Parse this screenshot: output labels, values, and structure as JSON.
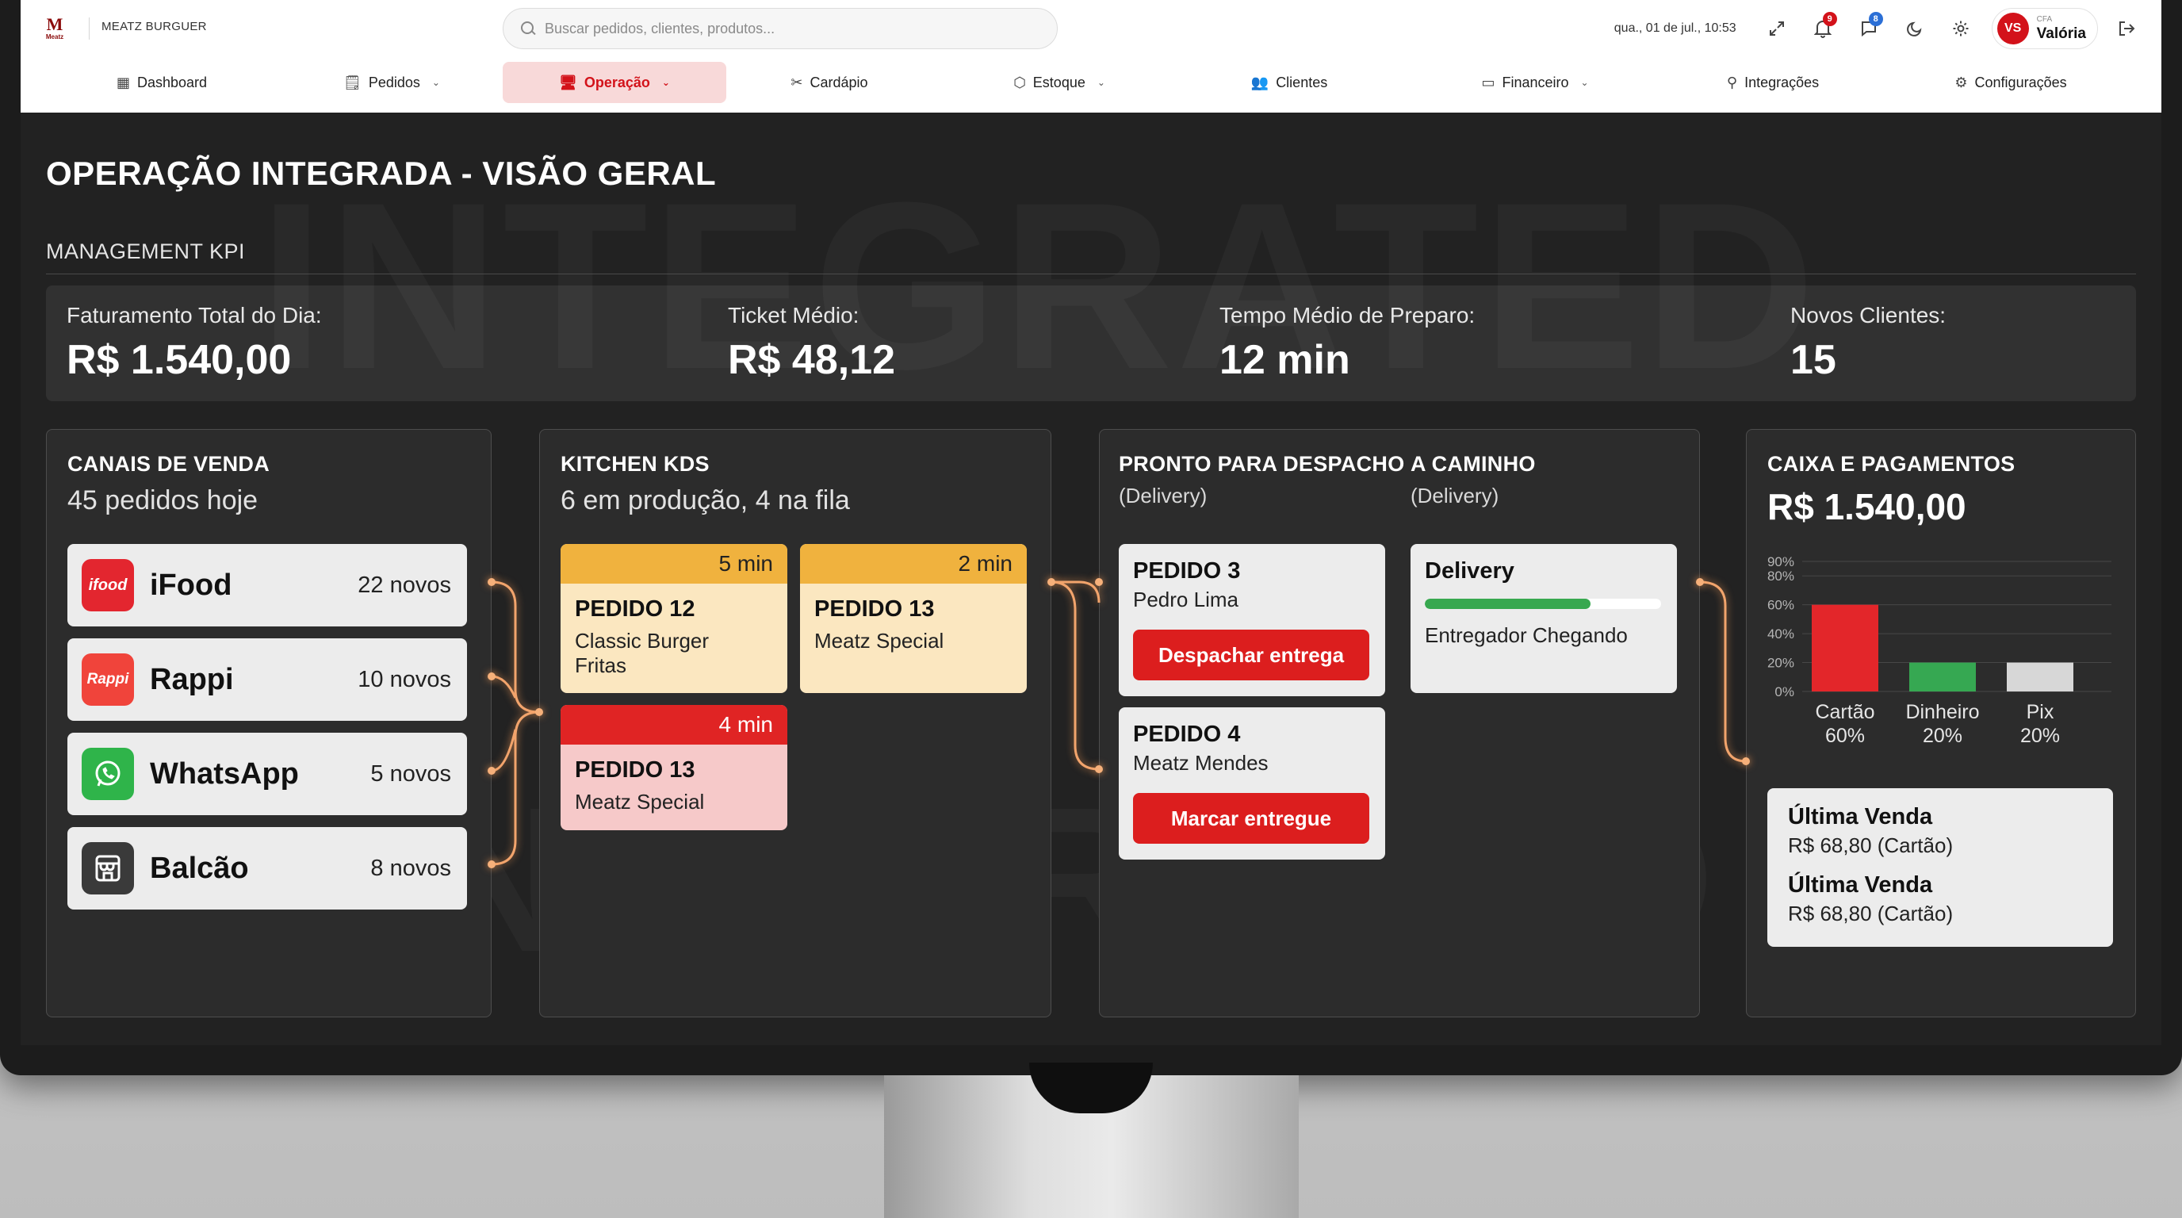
{
  "brand": {
    "logo_text": "M",
    "logo_sub": "Meatz",
    "name": "MEATZ BURGUER"
  },
  "search": {
    "placeholder": "Buscar pedidos, clientes, produtos..."
  },
  "header": {
    "datetime": "qua., 01 de jul., 10:53",
    "notifications_count": "9",
    "messages_count": "8",
    "user": {
      "initials": "VS",
      "role": "CFA",
      "name": "Valória"
    }
  },
  "nav": [
    {
      "label": "Dashboard",
      "icon": "grid-icon",
      "glyph": "▦",
      "dropdown": false,
      "active": false
    },
    {
      "label": "Pedidos",
      "icon": "receipt-icon",
      "glyph": "🗒",
      "dropdown": true,
      "active": false
    },
    {
      "label": "Operação",
      "icon": "monitor-icon",
      "glyph": "🖥",
      "dropdown": true,
      "active": true
    },
    {
      "label": "Cardápio",
      "icon": "utensils-icon",
      "glyph": "✂",
      "dropdown": false,
      "active": false
    },
    {
      "label": "Estoque",
      "icon": "box-icon",
      "glyph": "⬡",
      "dropdown": true,
      "active": false
    },
    {
      "label": "Clientes",
      "icon": "users-icon",
      "glyph": "👥",
      "dropdown": false,
      "active": false
    },
    {
      "label": "Financeiro",
      "icon": "wallet-icon",
      "glyph": "▭",
      "dropdown": true,
      "active": false
    },
    {
      "label": "Integrações",
      "icon": "plug-icon",
      "glyph": "⚲",
      "dropdown": false,
      "active": false
    },
    {
      "label": "Configurações",
      "icon": "gear-icon",
      "glyph": "⚙",
      "dropdown": false,
      "active": false
    }
  ],
  "page": {
    "title": "OPERAÇÃO INTEGRADA - VISÃO GERAL",
    "kpi_heading": "MANAGEMENT KPI",
    "watermark": "INTEGRATED"
  },
  "kpis": [
    {
      "label": "Faturamento Total do Dia:",
      "value": "R$ 1.540,00"
    },
    {
      "label": "Ticket Médio:",
      "value": "R$ 48,12"
    },
    {
      "label": "Tempo Médio de Preparo:",
      "value": "12 min"
    },
    {
      "label": "Novos Clientes:",
      "value": "15"
    }
  ],
  "channels": {
    "title": "CANAIS DE VENDA",
    "subtitle": "45 pedidos hoje",
    "items": [
      {
        "name": "iFood",
        "count": "22 novos",
        "logo_text": "ifood",
        "color": "#e3262f"
      },
      {
        "name": "Rappi",
        "count": "10 novos",
        "logo_text": "Rappi",
        "color": "#f0443b"
      },
      {
        "name": "WhatsApp",
        "count": "5 novos",
        "logo_text": "",
        "color": "#2fb44a"
      },
      {
        "name": "Balcão",
        "count": "8 novos",
        "logo_text": "",
        "color": "#3a3a3a"
      }
    ]
  },
  "kitchen": {
    "title": "KITCHEN KDS",
    "subtitle": "6 em produção, 4 na fila",
    "orders": [
      {
        "time": "5 min",
        "id": "PEDIDO 12",
        "items": [
          "Classic Burger",
          "Fritas"
        ],
        "status": "warning"
      },
      {
        "time": "2 min",
        "id": "PEDIDO 13",
        "items": [
          "Meatz Special"
        ],
        "status": "warning"
      },
      {
        "time": "4 min",
        "id": "PEDIDO 13",
        "items": [
          "Meatz Special"
        ],
        "status": "late"
      }
    ]
  },
  "dispatch": {
    "ready_title": "PRONTO PARA DESPACHO",
    "ready_sub": "(Delivery)",
    "transit_title": "A CAMINHO",
    "transit_sub": "(Delivery)",
    "ready_orders": [
      {
        "id": "PEDIDO 3",
        "customer": "Pedro Lima",
        "action": "Despachar entrega"
      },
      {
        "id": "PEDIDO 4",
        "customer": "Meatz Mendes",
        "action": "Marcar entregue"
      }
    ],
    "transit": {
      "title": "Delivery",
      "progress": 0.7,
      "status": "Entregador Chegando"
    }
  },
  "cash": {
    "title": "CAIXA E PAGAMENTOS",
    "total": "R$ 1.540,00",
    "last_sales": [
      {
        "title": "Última Venda",
        "value": "R$ 68,80 (Cartão)"
      },
      {
        "title": "Última Venda",
        "value": "R$ 68,80 (Cartão)"
      }
    ]
  },
  "chart_data": {
    "type": "bar",
    "categories": [
      "Cartão",
      "Dinheiro",
      "Pix"
    ],
    "values": [
      60,
      20,
      20
    ],
    "value_labels": [
      "60%",
      "20%",
      "20%"
    ],
    "colors": [
      "#e3262a",
      "#36a852",
      "#d7d7d7"
    ],
    "yticks": [
      "0%",
      "20%",
      "40%",
      "60%",
      "80%",
      "90%"
    ],
    "ytick_values": [
      0,
      20,
      40,
      60,
      80,
      90
    ],
    "ylim": [
      0,
      90
    ],
    "grid": true
  },
  "colors": {
    "accent": "#d3121a",
    "warning": "#f0b23e",
    "late": "#e02424",
    "success": "#37a84f"
  }
}
